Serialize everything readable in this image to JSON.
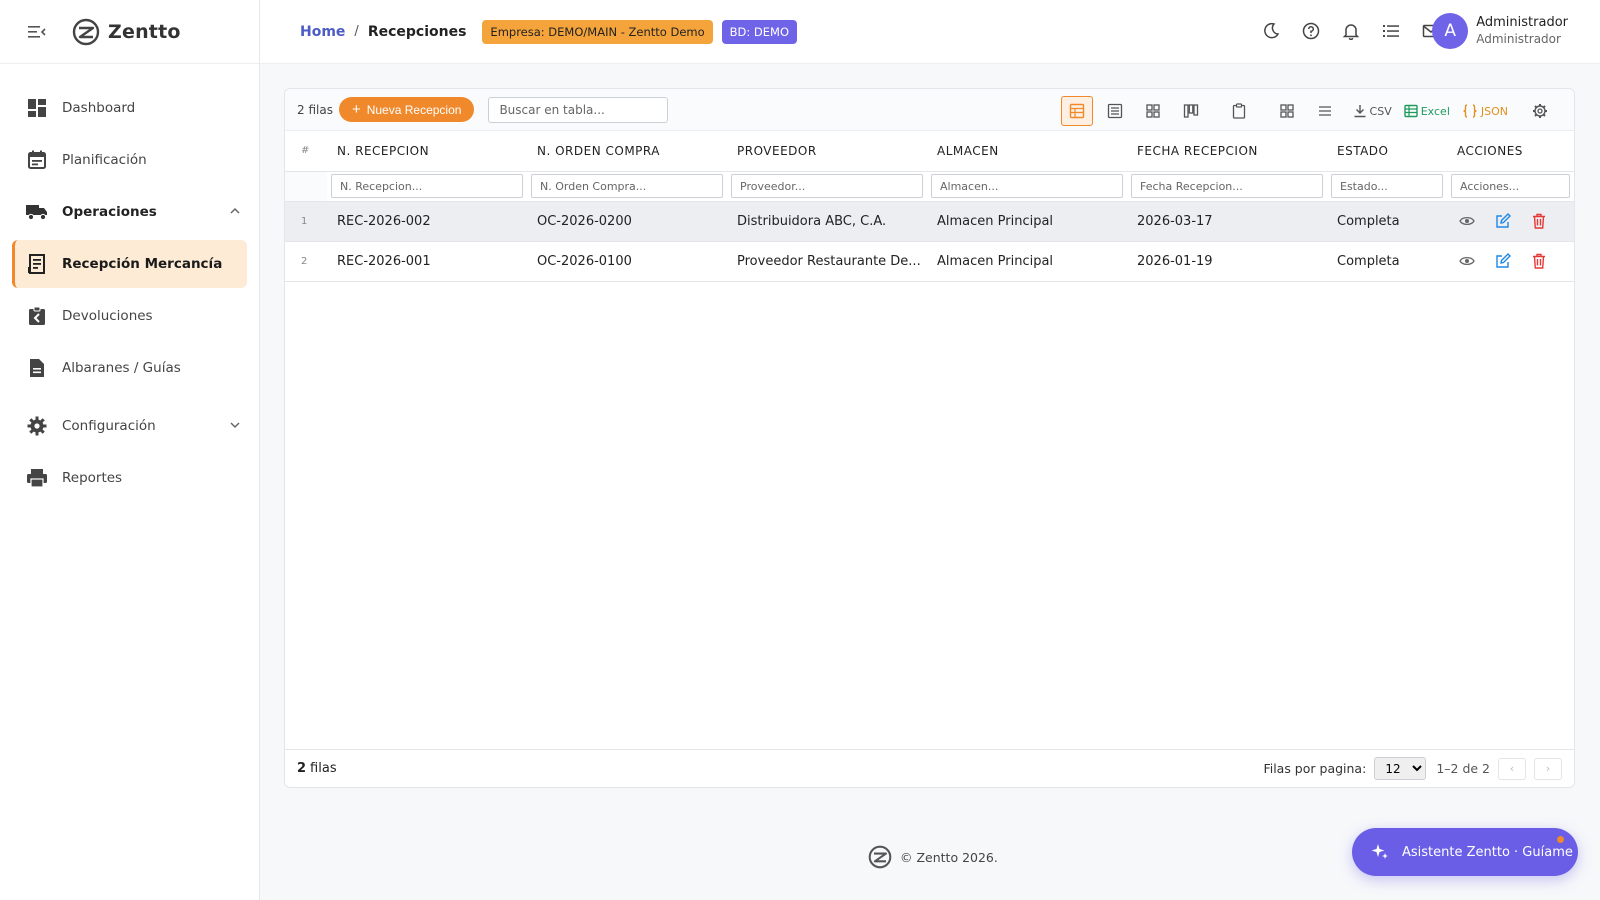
{
  "brand": {
    "name": "Zentto"
  },
  "sidebar": {
    "items": [
      {
        "label": "Dashboard"
      },
      {
        "label": "Planificación"
      },
      {
        "label": "Operaciones"
      },
      {
        "label": "Recepción Mercancía"
      },
      {
        "label": "Devoluciones"
      },
      {
        "label": "Albaranes / Guías"
      },
      {
        "label": "Configuración"
      },
      {
        "label": "Reportes"
      }
    ]
  },
  "header": {
    "breadcrumb_home": "Home",
    "breadcrumb_sep": "/",
    "breadcrumb_current": "Recepciones",
    "badge_empresa": "Empresa: DEMO/MAIN - Zentto Demo",
    "badge_bd": "BD: DEMO",
    "user": {
      "initial": "A",
      "name": "Administrador",
      "role": "Administrador"
    }
  },
  "toolbar": {
    "rows_count": "2 filas",
    "new_button": "Nueva Recepcion",
    "search_placeholder": "Buscar en tabla...",
    "csv": "CSV",
    "excel": "Excel",
    "json": "JSON"
  },
  "table": {
    "hash": "#",
    "columns": [
      "N. RECEPCION",
      "N. ORDEN COMPRA",
      "PROVEEDOR",
      "ALMACEN",
      "FECHA RECEPCION",
      "ESTADO",
      "ACCIONES"
    ],
    "filters": [
      "N. Recepcion...",
      "N. Orden Compra...",
      "Proveedor...",
      "Almacen...",
      "Fecha Recepcion...",
      "Estado...",
      "Acciones..."
    ],
    "rows": [
      {
        "idx": "1",
        "recepcion": "REC-2026-002",
        "orden": "OC-2026-0200",
        "proveedor": "Distribuidora ABC, C.A.",
        "almacen": "Almacen Principal",
        "fecha": "2026-03-17",
        "estado": "Completa"
      },
      {
        "idx": "2",
        "recepcion": "REC-2026-001",
        "orden": "OC-2026-0100",
        "proveedor": "Proveedor Restaurante De...",
        "almacen": "Almacen Principal",
        "fecha": "2026-01-19",
        "estado": "Completa"
      }
    ]
  },
  "footer": {
    "count_num": "2",
    "count_label": "filas",
    "per_page_label": "Filas por pagina:",
    "per_page_value": "12",
    "range": "1–2 de 2",
    "prev": "‹",
    "next": "›"
  },
  "copyright": "© Zentto 2026.",
  "assistant": "Asistente Zentto · Guíame",
  "colors": {
    "accent": "#f0892b",
    "purple": "#6f63e8",
    "link": "#4b5cc4",
    "danger": "#e53935",
    "edit": "#1e88e5"
  },
  "icons": [
    "menu-collapse-icon",
    "zentto-logo-icon",
    "dashboard-icon",
    "calendar-icon",
    "truck-icon",
    "receipt-icon",
    "return-icon",
    "document-icon",
    "gear-icon",
    "printer-icon",
    "moon-icon",
    "help-icon",
    "bell-icon",
    "list-icon",
    "mail-icon",
    "eye-icon",
    "edit-icon",
    "trash-icon",
    "sparkle-icon"
  ]
}
